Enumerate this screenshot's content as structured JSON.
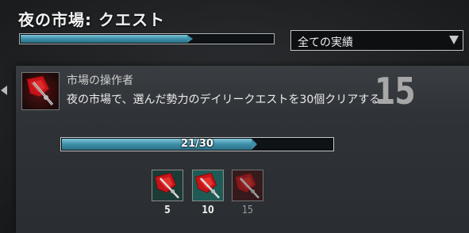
{
  "category": {
    "title": "夜の市場: クエスト",
    "progress_fraction": 0.66
  },
  "filter": {
    "selected": "全ての実績"
  },
  "achievement": {
    "title": "市場の操作者",
    "description": "夜の市場で、選んだ勢力のデイリークエストを30個クリアする",
    "points": "15",
    "progress_label": "21/30",
    "progress_fraction": 0.7
  },
  "tiers": [
    {
      "label": "5",
      "completed": true
    },
    {
      "label": "10",
      "completed": true
    },
    {
      "label": "15",
      "completed": false
    }
  ],
  "colors": {
    "bar_fill": "#3d8fa9",
    "icon_red": "#c4141a",
    "icon_teal": "#41b5a8"
  },
  "icons": {
    "achievement": "red-axe-emblem-icon"
  }
}
